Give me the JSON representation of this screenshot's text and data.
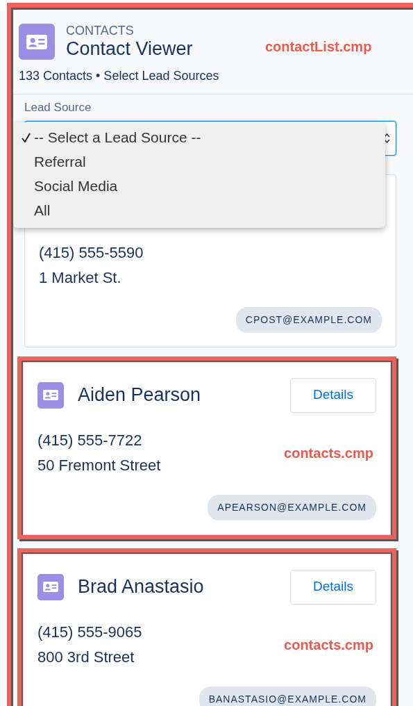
{
  "header": {
    "object_label": "CONTACTS",
    "title": "Contact Viewer",
    "summary": "133 Contacts • Select Lead Sources",
    "annotation": "contactList.cmp"
  },
  "lead_source": {
    "label": "Lead Source",
    "expanded": true,
    "options": [
      {
        "label": "-- Select a Lead Source --",
        "selected": true
      },
      {
        "label": "Referral",
        "selected": false
      },
      {
        "label": "Social Media",
        "selected": false
      },
      {
        "label": "All",
        "selected": false
      }
    ]
  },
  "contacts": [
    {
      "phone": "(415) 555-5590",
      "address": "1 Market St.",
      "email": "CPOST@EXAMPLE.COM"
    },
    {
      "name": "Aiden Pearson",
      "button": "Details",
      "phone": "(415) 555-7722",
      "address": "50 Fremont Street",
      "email": "APEARSON@EXAMPLE.COM",
      "annotation": "contacts.cmp"
    },
    {
      "name": "Brad Anastasio",
      "button": "Details",
      "phone": "(415) 555-9065",
      "address": "800 3rd Street",
      "email": "BANASTASIO@EXAMPLE.COM",
      "annotation": "contacts.cmp"
    }
  ]
}
